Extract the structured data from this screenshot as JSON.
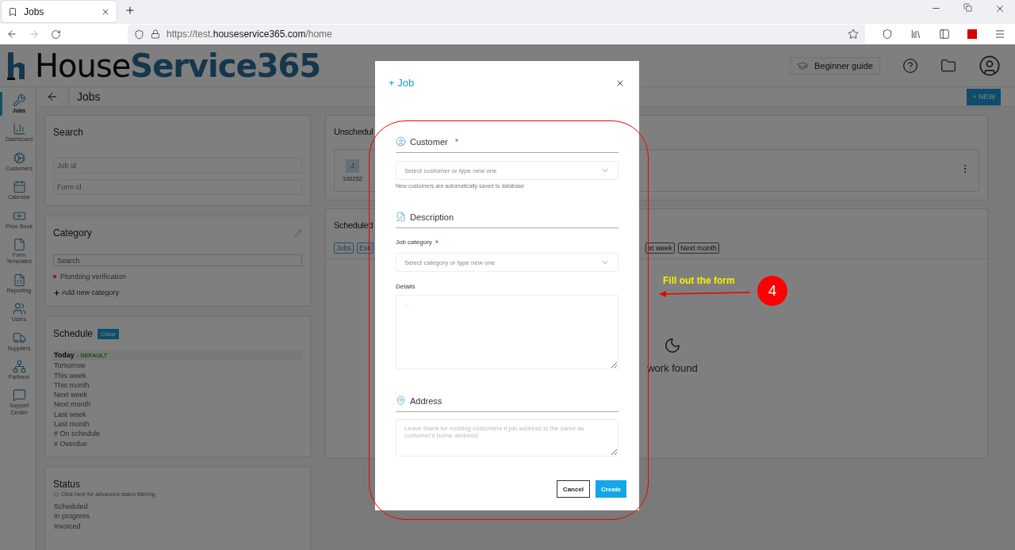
{
  "browser": {
    "tab": {
      "title": "Jobs",
      "selected": true
    },
    "url": "https://test.**houseservice365.com**/home"
  },
  "header": {
    "logo": "House**Service365**",
    "guide_button": "Beginner guide"
  },
  "sidebar": {
    "items": [
      {
        "label": "Jobs",
        "selected": true
      },
      {
        "label": "Dashboard",
        "selected": false
      },
      {
        "label": "Customers",
        "selected": false
      },
      {
        "label": "Calendar",
        "selected": false
      },
      {
        "label": "Price Book",
        "selected": false
      },
      {
        "label": "Form Templates",
        "selected": false
      },
      {
        "label": "Reporting",
        "selected": false
      },
      {
        "label": "Users",
        "selected": false
      },
      {
        "label": "Suppliers",
        "selected": false
      },
      {
        "label": "Partners",
        "selected": false
      },
      {
        "label": "Support Center",
        "selected": false
      }
    ]
  },
  "page": {
    "title": "Jobs",
    "new_button": "+ NEW"
  },
  "search_card": {
    "title": "Search",
    "fields": [
      {
        "placeholder": "Job id"
      },
      {
        "placeholder": "Form id"
      }
    ]
  },
  "category_card": {
    "title": "Category",
    "search": {
      "placeholder": "Search"
    },
    "items": [
      {
        "label": "Plumbing verification",
        "color": "#8a2447"
      }
    ],
    "add_link": "Add new category"
  },
  "schedule_card": {
    "title": "Schedule",
    "clear_button": "Clear",
    "items": [
      {
        "label": "Today",
        "badge": "- DEFAULT",
        "selected": true
      },
      {
        "label": "Tomorrow",
        "selected": false
      },
      {
        "label": "This week",
        "selected": false
      },
      {
        "label": "This month",
        "selected": false
      },
      {
        "label": "Next week",
        "selected": false
      },
      {
        "label": "Next month",
        "selected": false
      },
      {
        "label": "Last week",
        "selected": false
      },
      {
        "label": "Last month",
        "selected": false
      },
      {
        "label": "# On schedule",
        "selected": false
      },
      {
        "label": "# Overdue",
        "selected": false
      }
    ]
  },
  "status_card": {
    "title": "Status",
    "hint": "Click here for advanced status filtering",
    "items": [
      {
        "label": "Scheduled",
        "selected": false
      },
      {
        "label": "In progress",
        "selected": false
      },
      {
        "label": "Invoiced",
        "selected": false
      }
    ]
  },
  "unscheduled_card": {
    "title": "Unschedul",
    "job": {
      "avatar": "J",
      "number": "100252"
    }
  },
  "scheduled_card": {
    "title": "Scheduled",
    "chips_left": [
      {
        "label": "Jobs",
        "selected": true
      },
      {
        "label": "Esti",
        "selected": true
      }
    ],
    "chips_right": [
      {
        "label": "xt week",
        "selected": false
      },
      {
        "label": "Next month",
        "selected": false
      }
    ],
    "empty_text": "work found"
  },
  "modal": {
    "title": "+ Job",
    "sections": [
      {
        "kind": "select",
        "heading": "Customer",
        "required_mark": "*",
        "placeholder": "Select customer or type new one",
        "hint": "New customers are automatically saved to database"
      },
      {
        "kind": "description",
        "heading": "Description",
        "label": "Job category",
        "required_mark": "*",
        "placeholder": "Select category or type new one",
        "details_label": "Details",
        "details_placeholder": "..."
      },
      {
        "kind": "textarea",
        "heading": "Address",
        "placeholder": "Leave blank for existing customers if job address is the same as customer's home address!"
      }
    ],
    "buttons": [
      {
        "label": "Cancel",
        "kind": "secondary"
      },
      {
        "label": "Create",
        "kind": "primary"
      }
    ]
  },
  "callout": {
    "text": "Fill out the form",
    "step": "4"
  }
}
